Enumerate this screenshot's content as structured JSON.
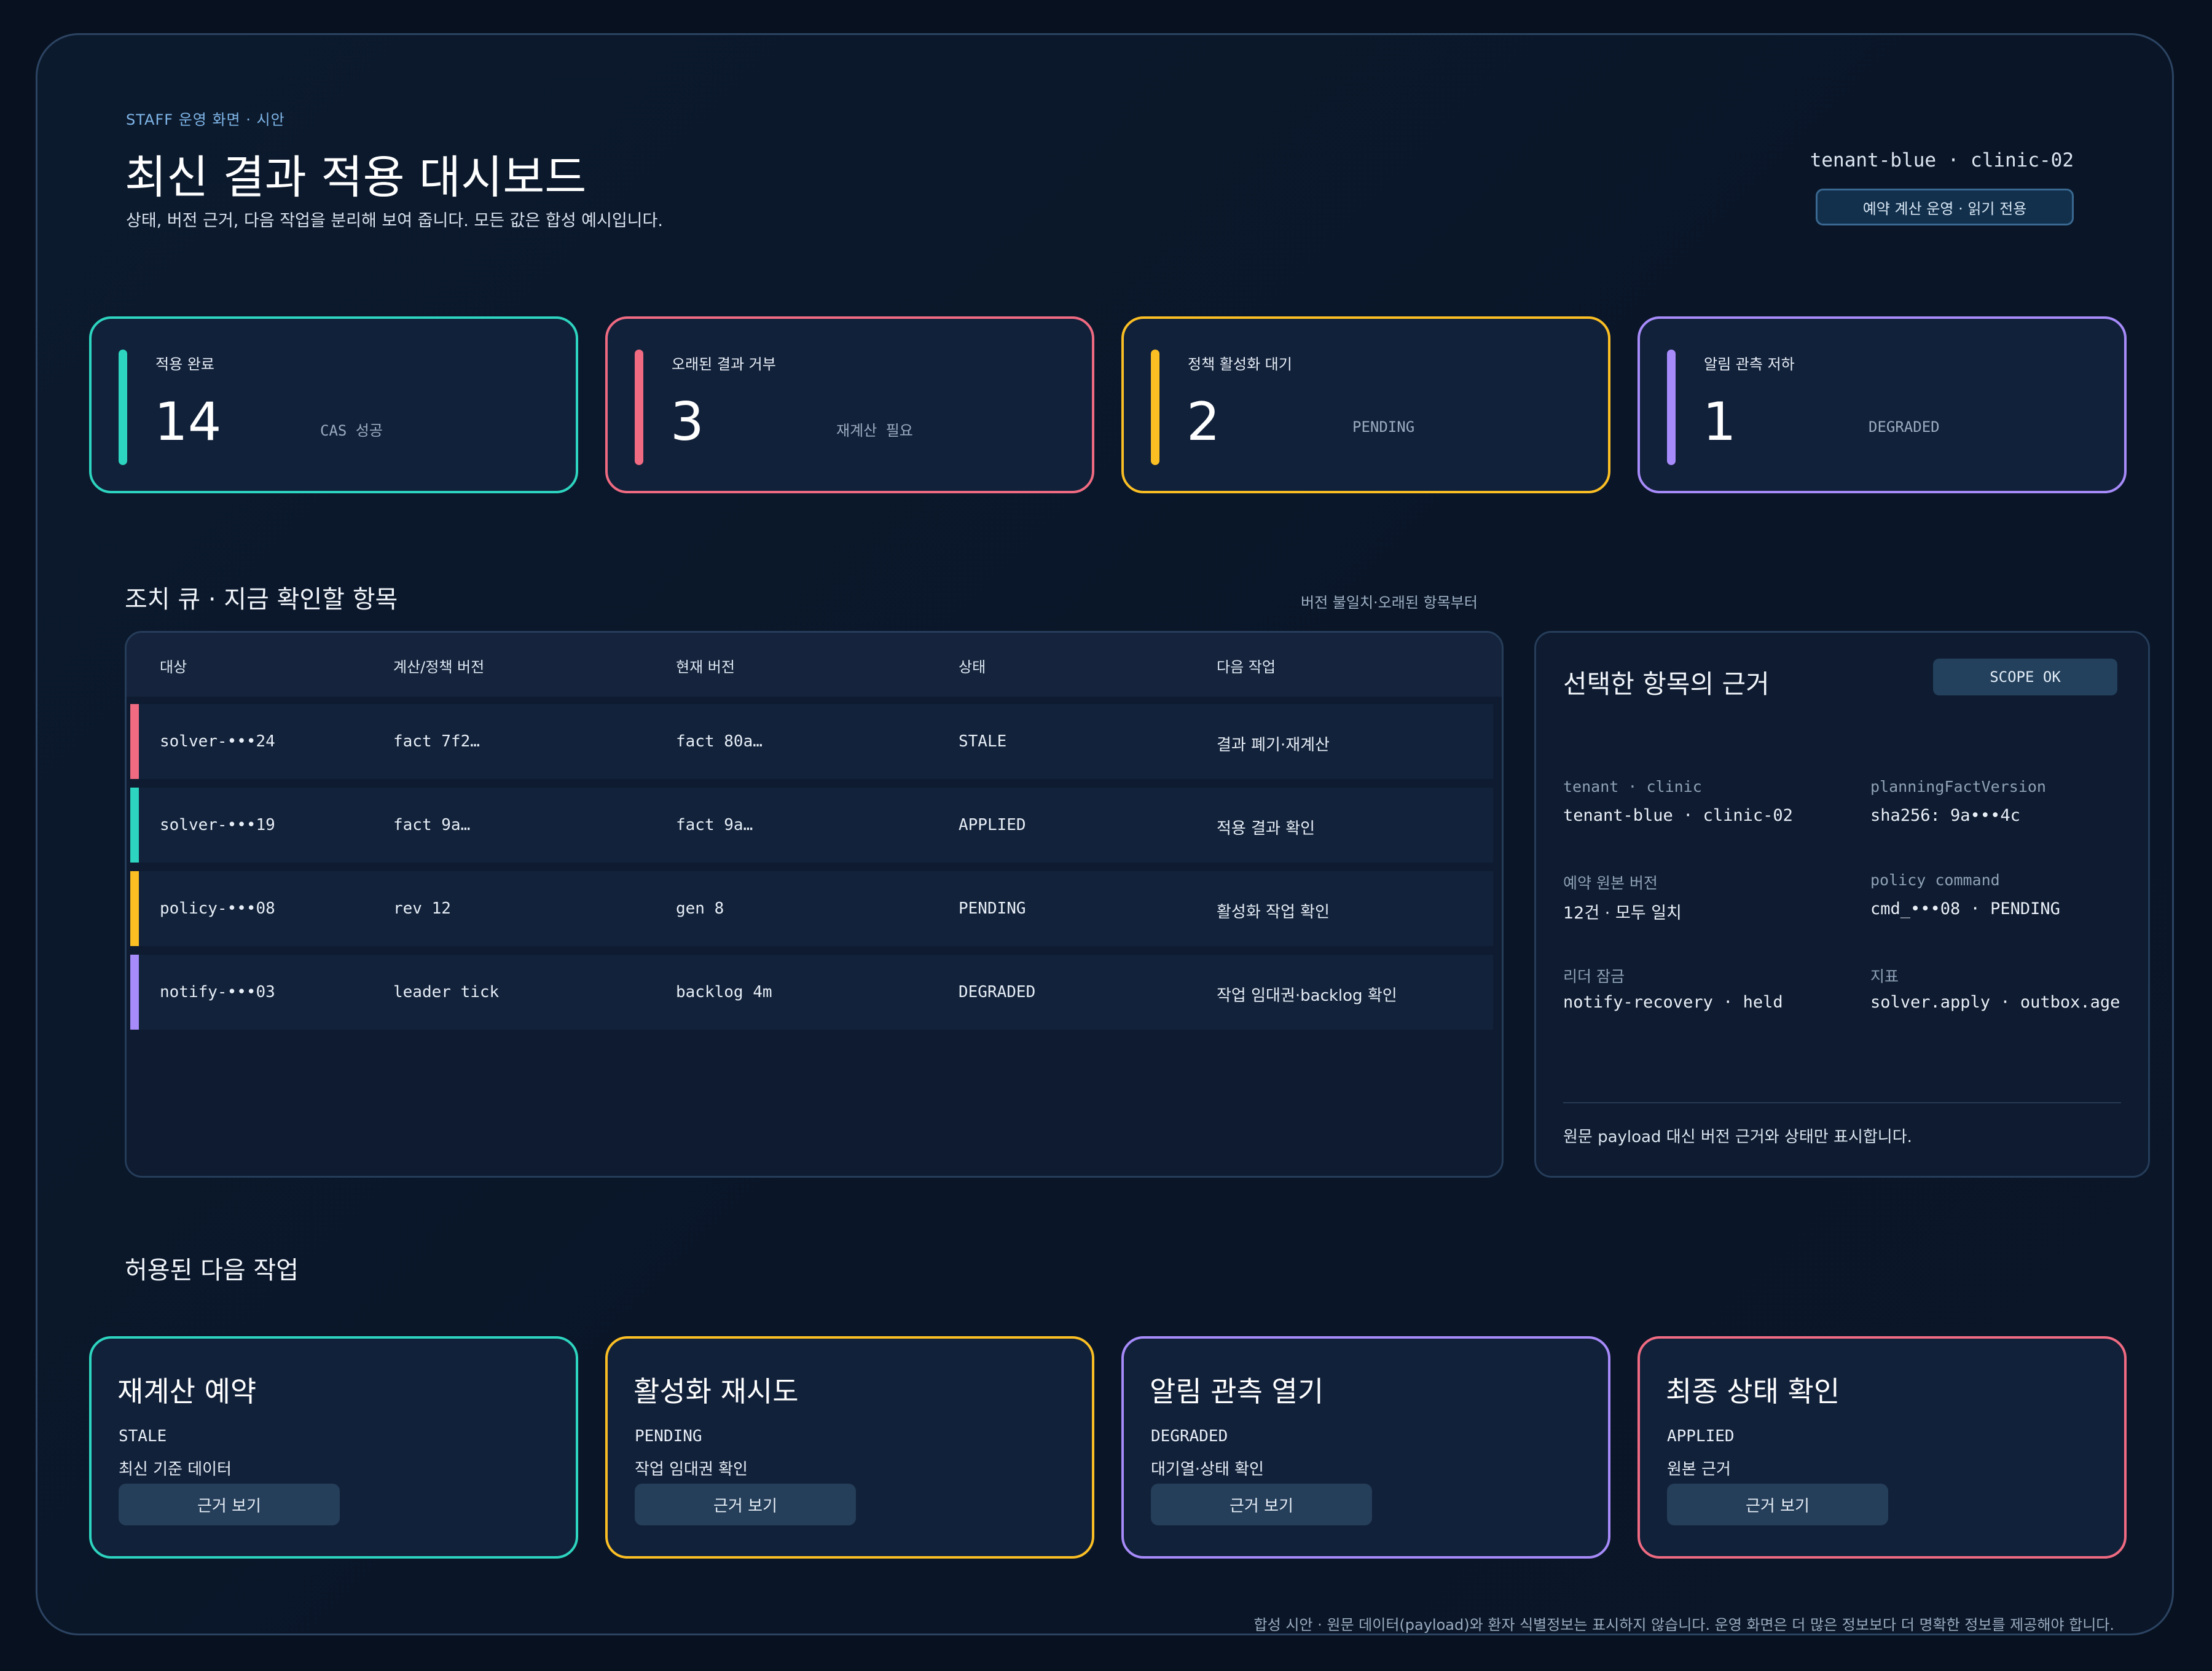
{
  "header": {
    "eyebrow": "STAFF 운영 화면 · 시안",
    "title": "최신 결과 적용 대시보드",
    "subtitle": "상태, 버전 근거, 다음 작업을 분리해 보여 줍니다. 모든 값은 합성 예시입니다.",
    "tenant": "tenant-blue · clinic-02",
    "mode_pill": "예약 계산 운영 · 읽기 전용"
  },
  "kpis": [
    {
      "label": "적용 완료",
      "value": "14",
      "note": "CAS 성공",
      "color": "#2dd4bf"
    },
    {
      "label": "오래된 결과 거부",
      "value": "3",
      "note": "재계산 필요",
      "color": "#f06b82"
    },
    {
      "label": "정책 활성화 대기",
      "value": "2",
      "note": "PENDING",
      "color": "#fbbf24"
    },
    {
      "label": "알림 관측 저하",
      "value": "1",
      "note": "DEGRADED",
      "color": "#a78bfa"
    }
  ],
  "queue": {
    "title": "조치 큐 · 지금 확인할 항목",
    "hint": "버전 불일치·오래된 항목부터",
    "columns": [
      "대상",
      "계산/정책 버전",
      "현재 버전",
      "상태",
      "다음 작업"
    ],
    "rows": [
      {
        "target": "solver-•••24",
        "calc_version": "fact 7f2…",
        "current_version": "fact 80a…",
        "status": "STALE",
        "next": "결과 폐기·재계산",
        "color": "#f06b82"
      },
      {
        "target": "solver-•••19",
        "calc_version": "fact 9a…",
        "current_version": "fact 9a…",
        "status": "APPLIED",
        "next": "적용 결과 확인",
        "color": "#2dd4bf"
      },
      {
        "target": "policy-•••08",
        "calc_version": "rev 12",
        "current_version": "gen 8",
        "status": "PENDING",
        "next": "활성화 작업 확인",
        "color": "#fbbf24"
      },
      {
        "target": "notify-•••03",
        "calc_version": "leader tick",
        "current_version": "backlog 4m",
        "status": "DEGRADED",
        "next": "작업 임대권·backlog 확인",
        "color": "#a78bfa"
      }
    ]
  },
  "evidence": {
    "title": "선택한 항목의 근거",
    "scope_button": "SCOPE OK",
    "fields": [
      {
        "key": "tenant · clinic",
        "value": "tenant-blue · clinic-02"
      },
      {
        "key": "planningFactVersion",
        "value": "sha256: 9a•••4c"
      },
      {
        "key": "예약 원본 버전",
        "value": "12건 · 모두 일치"
      },
      {
        "key": "policy command",
        "value": "cmd_•••08 · PENDING"
      },
      {
        "key": "리더 잠금",
        "value": "notify-recovery · held"
      },
      {
        "key": "지표",
        "value": "solver.apply · outbox.age"
      }
    ],
    "footer": "원문 payload 대신 버전 근거와 상태만 표시합니다."
  },
  "actions": {
    "title": "허용된 다음 작업",
    "cards": [
      {
        "title": "재계산 예약",
        "status": "STALE",
        "desc": "최신 기준 데이터",
        "button": "근거 보기",
        "color": "#2dd4bf"
      },
      {
        "title": "활성화 재시도",
        "status": "PENDING",
        "desc": "작업 임대권 확인",
        "button": "근거 보기",
        "color": "#fbbf24"
      },
      {
        "title": "알림 관측 열기",
        "status": "DEGRADED",
        "desc": "대기열·상태 확인",
        "button": "근거 보기",
        "color": "#a78bfa"
      },
      {
        "title": "최종 상태 확인",
        "status": "APPLIED",
        "desc": "원본 근거",
        "button": "근거 보기",
        "color": "#f06b82"
      }
    ]
  },
  "footnote": "합성 시안 · 원문 데이터(payload)와 환자 식별정보는 표시하지 않습니다. 운영 화면은 더 많은 정보보다 더 명확한 정보를 제공해야 합니다."
}
